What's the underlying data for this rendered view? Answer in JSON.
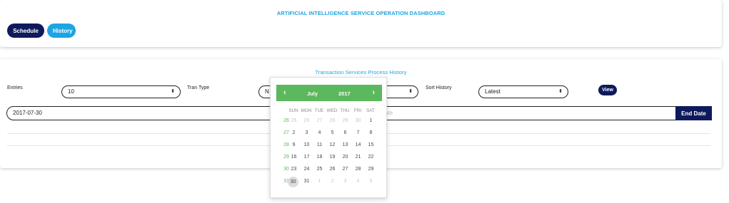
{
  "header": {
    "title": "ARTIFICIAL INTELLIGENCE SERVICE OPERATION DASHBOARD",
    "schedule_label": "Schedule",
    "history_label": "History"
  },
  "history": {
    "title": "Transaction Services Process History",
    "entries_label": "Entries",
    "entries_value": "10",
    "tran_type_label": "Tran Type",
    "tran_type_value": "N",
    "sort_label": "Sort History",
    "sort_value": "Latest",
    "view_label": "View",
    "start_date": "2017-07-30",
    "end_date_placeholder": "ate",
    "end_date_button": "End Date"
  },
  "datepicker": {
    "month": "July",
    "year": "2017",
    "prev_icon": "chevron-left-icon",
    "next_icon": "chevron-right-icon",
    "weekdays": [
      "SUN",
      "MON",
      "TUE",
      "WED",
      "THU",
      "FRI",
      "SAT"
    ],
    "weeks": [
      {
        "num": "26",
        "days": [
          [
            "25",
            1
          ],
          [
            "26",
            1
          ],
          [
            "27",
            1
          ],
          [
            "28",
            1
          ],
          [
            "29",
            1
          ],
          [
            "30",
            1
          ],
          [
            "1",
            0
          ]
        ]
      },
      {
        "num": "27",
        "days": [
          [
            "2",
            0
          ],
          [
            "3",
            0
          ],
          [
            "4",
            0
          ],
          [
            "5",
            0
          ],
          [
            "6",
            0
          ],
          [
            "7",
            0
          ],
          [
            "8",
            0
          ]
        ]
      },
      {
        "num": "28",
        "days": [
          [
            "9",
            0
          ],
          [
            "10",
            0
          ],
          [
            "11",
            0
          ],
          [
            "12",
            0
          ],
          [
            "13",
            0
          ],
          [
            "14",
            0
          ],
          [
            "15",
            0
          ]
        ]
      },
      {
        "num": "29",
        "days": [
          [
            "16",
            0
          ],
          [
            "17",
            0
          ],
          [
            "18",
            0
          ],
          [
            "19",
            0
          ],
          [
            "20",
            0
          ],
          [
            "21",
            0
          ],
          [
            "22",
            0
          ]
        ]
      },
      {
        "num": "30",
        "days": [
          [
            "23",
            0
          ],
          [
            "24",
            0
          ],
          [
            "25",
            0
          ],
          [
            "26",
            0
          ],
          [
            "27",
            0
          ],
          [
            "28",
            0
          ],
          [
            "29",
            0
          ]
        ]
      },
      {
        "num": "31",
        "days": [
          [
            "30",
            2
          ],
          [
            "31",
            0
          ],
          [
            "1",
            1
          ],
          [
            "2",
            1
          ],
          [
            "3",
            1
          ],
          [
            "4",
            1
          ],
          [
            "5",
            1
          ]
        ]
      }
    ]
  },
  "colors": {
    "primary": "#0e1a5c",
    "accent": "#1ca4e3",
    "calendar_green": "#5cb85c"
  }
}
